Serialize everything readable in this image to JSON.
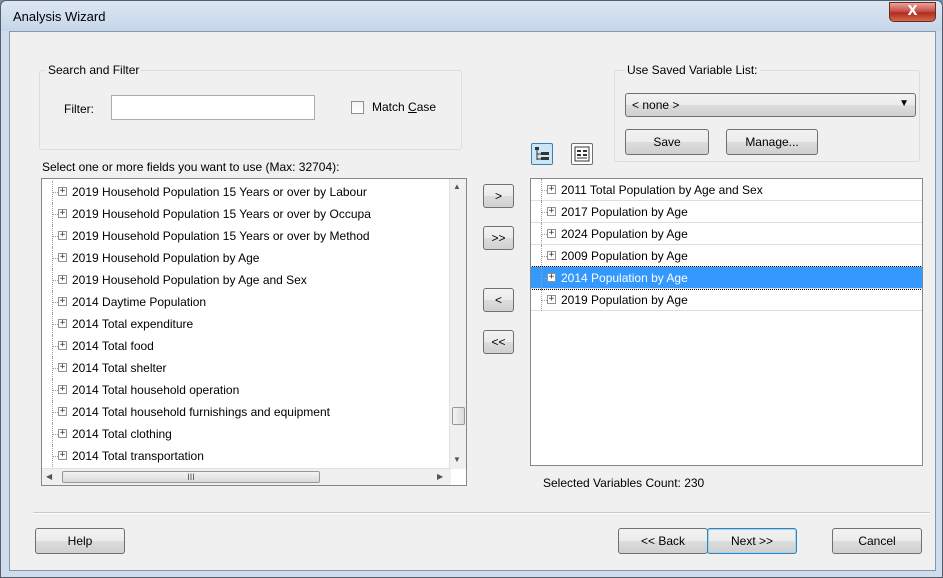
{
  "window": {
    "title": "Analysis Wizard",
    "close_glyph": "X"
  },
  "search_filter": {
    "group_label": "Search and Filter",
    "filter_label": "Filter:",
    "filter_value": "",
    "match_case_label": "Match Case",
    "match_case_checked": false
  },
  "saved_list": {
    "group_label": "Use Saved Variable List:",
    "selected": "< none >",
    "save_label": "Save",
    "manage_label": "Manage..."
  },
  "available": {
    "label": "Select one or more fields you want to use (Max: 32704):",
    "items": [
      "2019 Household Population 15 Years or over by Labour",
      "2019 Household Population 15 Years or over by Occupa",
      "2019 Household Population 15 Years or over by Method",
      "2019 Household Population by Age",
      "2019 Household Population by Age and Sex",
      "2014 Daytime Population",
      "2014 Total expenditure",
      "2014 Total food",
      "2014 Total shelter",
      "2014 Total household operation",
      "2014 Total household furnishings and equipment",
      "2014 Total clothing",
      "2014 Total transportation"
    ],
    "hscroll_grip": "III"
  },
  "transfer_buttons": {
    "add": ">",
    "add_all": ">>",
    "remove": "<",
    "remove_all": "<<"
  },
  "selected": {
    "items": [
      "2011 Total Population by Age and Sex",
      "2017 Population by Age",
      "2024 Population by Age",
      "2009 Population by Age",
      "2014 Population by Age",
      "2019 Population by Age"
    ],
    "selected_index": 4,
    "count_label": "Selected Variables Count: 230"
  },
  "view_icons": [
    "tree-view-icon",
    "list-view-icon"
  ],
  "footer": {
    "help_label": "Help",
    "back_label": "<< Back",
    "next_label": "Next >>",
    "cancel_label": "Cancel"
  },
  "colors": {
    "selection": "#3399ff",
    "dialog_bg": "#f0f0f0",
    "close_red": "#c75050"
  }
}
